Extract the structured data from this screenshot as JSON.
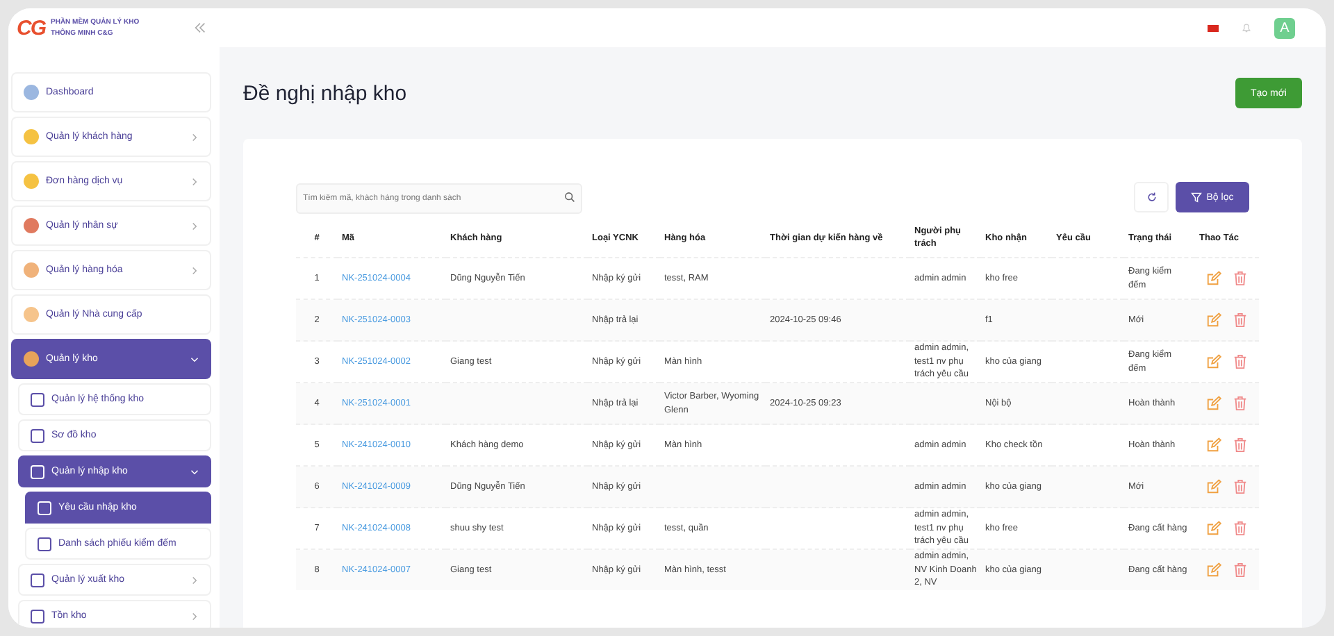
{
  "app": {
    "logo": "CG",
    "name": "PHẦN MỀM QUẢN LÝ KHO THÔNG MINH C&G",
    "avatar": "A"
  },
  "sidebar": {
    "items": [
      {
        "label": "Dashboard",
        "kind": "link",
        "selected": false
      },
      {
        "label": "Quản lý khách hàng",
        "kind": "group",
        "selected": false,
        "expanded": false
      },
      {
        "label": "Đơn hàng dịch vụ",
        "kind": "group",
        "selected": false,
        "expanded": false
      },
      {
        "label": "Quản lý nhân sự",
        "kind": "group",
        "selected": false,
        "expanded": false
      },
      {
        "label": "Quản lý hàng hóa",
        "kind": "group",
        "selected": false,
        "expanded": false
      },
      {
        "label": "Quản lý Nhà cung cấp",
        "kind": "link",
        "selected": false
      },
      {
        "label": "Quản lý kho",
        "kind": "group",
        "selected": true,
        "expanded": true,
        "children": [
          {
            "label": "Quản lý hệ thống kho",
            "kind": "link",
            "selected": false
          },
          {
            "label": "Sơ đồ kho",
            "kind": "link",
            "selected": false
          },
          {
            "label": "Quản lý nhập kho",
            "kind": "group",
            "selected": true,
            "expanded": true,
            "children": [
              {
                "label": "Yêu cầu nhập kho",
                "selected": true
              },
              {
                "label": "Danh sách phiếu kiểm đếm",
                "selected": false
              }
            ]
          },
          {
            "label": "Quản lý xuất kho",
            "kind": "group",
            "selected": false,
            "expanded": false
          },
          {
            "label": "Tồn kho",
            "kind": "group",
            "selected": false,
            "expanded": false
          }
        ]
      }
    ]
  },
  "page": {
    "title": "Đề nghị nhập kho",
    "create_button": "Tạo mới"
  },
  "toolbar": {
    "search": {
      "placeholder": "Tìm kiếm mã, khách hàng trong danh sách"
    },
    "filter_button": "Bộ lọc"
  },
  "table": {
    "columns": [
      "#",
      "Mã",
      "Khách hàng",
      "Loại YCNK",
      "Hàng hóa",
      "Thời gian dự kiến hàng về",
      "Người phụ trách",
      "Kho nhận",
      "Yêu cầu",
      "Trạng thái",
      "Thao Tác"
    ],
    "rows": [
      {
        "no": "1",
        "code": "NK-251024-0004",
        "customer": "Dũng Nguyễn Tiến",
        "type": "Nhập ký gửi",
        "goods": "tesst, RAM",
        "eta": "",
        "owner": "admin admin",
        "warehouse": "kho free",
        "request": "",
        "status": "Đang kiểm đếm"
      },
      {
        "no": "2",
        "code": "NK-251024-0003",
        "customer": "",
        "type": "Nhập trả lại",
        "goods": "",
        "eta": "2024-10-25 09:46",
        "owner": "",
        "warehouse": "f1",
        "request": "",
        "status": "Mới"
      },
      {
        "no": "3",
        "code": "NK-251024-0002",
        "customer": "Giang test",
        "type": "Nhập ký gửi",
        "goods": "Màn hình",
        "eta": "",
        "owner": "admin admin, test1 nv phụ trách yêu cầu",
        "warehouse": "kho của giang",
        "request": "",
        "status": "Đang kiểm đếm"
      },
      {
        "no": "4",
        "code": "NK-251024-0001",
        "customer": "",
        "type": "Nhập trả lại",
        "goods": "Victor Barber, Wyoming Glenn",
        "eta": "2024-10-25 09:23",
        "owner": "",
        "warehouse": "Nội bộ",
        "request": "",
        "status": "Hoàn thành"
      },
      {
        "no": "5",
        "code": "NK-241024-0010",
        "customer": "Khách hàng demo",
        "type": "Nhập ký gửi",
        "goods": "Màn hình",
        "eta": "",
        "owner": "admin admin",
        "warehouse": "Kho check tồn",
        "request": "",
        "status": "Hoàn thành"
      },
      {
        "no": "6",
        "code": "NK-241024-0009",
        "customer": "Dũng Nguyễn Tiến",
        "type": "Nhập ký gửi",
        "goods": "",
        "eta": "",
        "owner": "admin admin",
        "warehouse": "kho của giang",
        "request": "",
        "status": "Mới"
      },
      {
        "no": "7",
        "code": "NK-241024-0008",
        "customer": "shuu shy test",
        "type": "Nhập ký gửi",
        "goods": "tesst, quần",
        "eta": "",
        "owner": "admin admin, test1 nv phụ trách yêu cầu",
        "warehouse": "kho free",
        "request": "",
        "status": "Đang cất hàng"
      },
      {
        "no": "8",
        "code": "NK-241024-0007",
        "customer": "Giang test",
        "type": "Nhập ký gửi",
        "goods": "Màn hình, tesst",
        "eta": "",
        "owner": "admin admin, NV Kinh Doanh 2, NV",
        "warehouse": "kho của giang",
        "request": "",
        "status": "Đang cất hàng"
      }
    ]
  }
}
